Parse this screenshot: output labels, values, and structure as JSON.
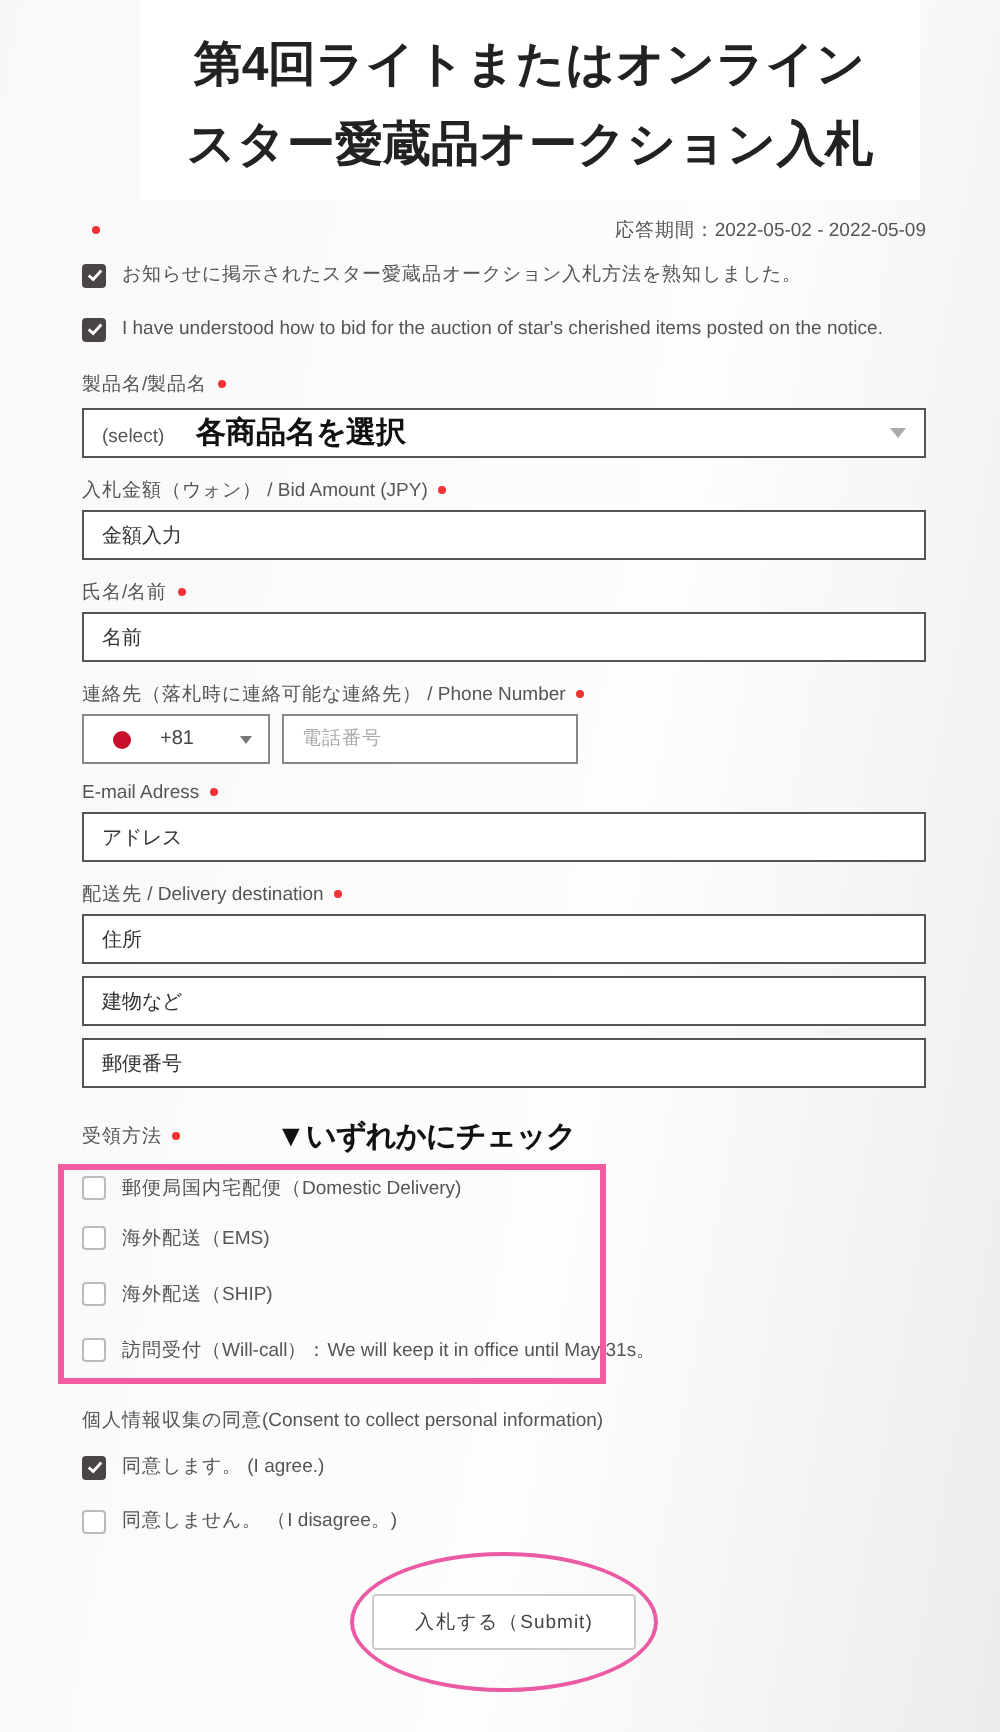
{
  "title": [
    "第4回ライトまたはオンライン",
    "スター愛蔵品オークション入札"
  ],
  "header": {
    "required_mark": true,
    "period": "応答期間：2022-05-02 - 2022-05-09"
  },
  "agreements": [
    {
      "label": "お知らせに掲示されたスター愛蔵品オークション入札方法を熟知しました。",
      "checked": true
    },
    {
      "label": "I have understood how to bid for the auction of star's cherished items posted on the notice.",
      "checked": true
    }
  ],
  "product": {
    "label": "製品名/製品名",
    "required": true,
    "value": "(select)",
    "annotation": "各商品名を選択"
  },
  "bid": {
    "label": "入札金額（ウォン） / Bid Amount (JPY)",
    "required": true,
    "value": "金額入力"
  },
  "name": {
    "label": "氏名/名前",
    "required": true,
    "value": "名前"
  },
  "phone": {
    "label": "連絡先（落札時に連絡可能な連絡先） / Phone Number",
    "required": true,
    "country_code": "+81",
    "placeholder": "電話番号"
  },
  "email": {
    "label": "E-mail Adress",
    "required": true,
    "value": "アドレス"
  },
  "delivery": {
    "label": "配送先 / Delivery destination",
    "required": true,
    "values": [
      "住所",
      "建物など",
      "郵便番号"
    ]
  },
  "receipt": {
    "label": "受領方法",
    "required": true,
    "annotation": "▼いずれかにチェック",
    "options": [
      {
        "label": "郵便局国内宅配便（Domestic Delivery)",
        "checked": false
      },
      {
        "label": "海外配送（EMS)",
        "checked": false
      },
      {
        "label": "海外配送（SHIP)",
        "checked": false
      },
      {
        "label": "訪問受付（Will-call）：We will keep it in office until May 31s。",
        "checked": false
      }
    ]
  },
  "consent": {
    "label": "個人情報収集の同意(Consent to collect personal information)",
    "options": [
      {
        "label": "同意します。 (I agree.)",
        "checked": true
      },
      {
        "label": "同意しません。 （I disagree。)",
        "checked": false
      }
    ]
  },
  "submit": "入札する（Submit)"
}
